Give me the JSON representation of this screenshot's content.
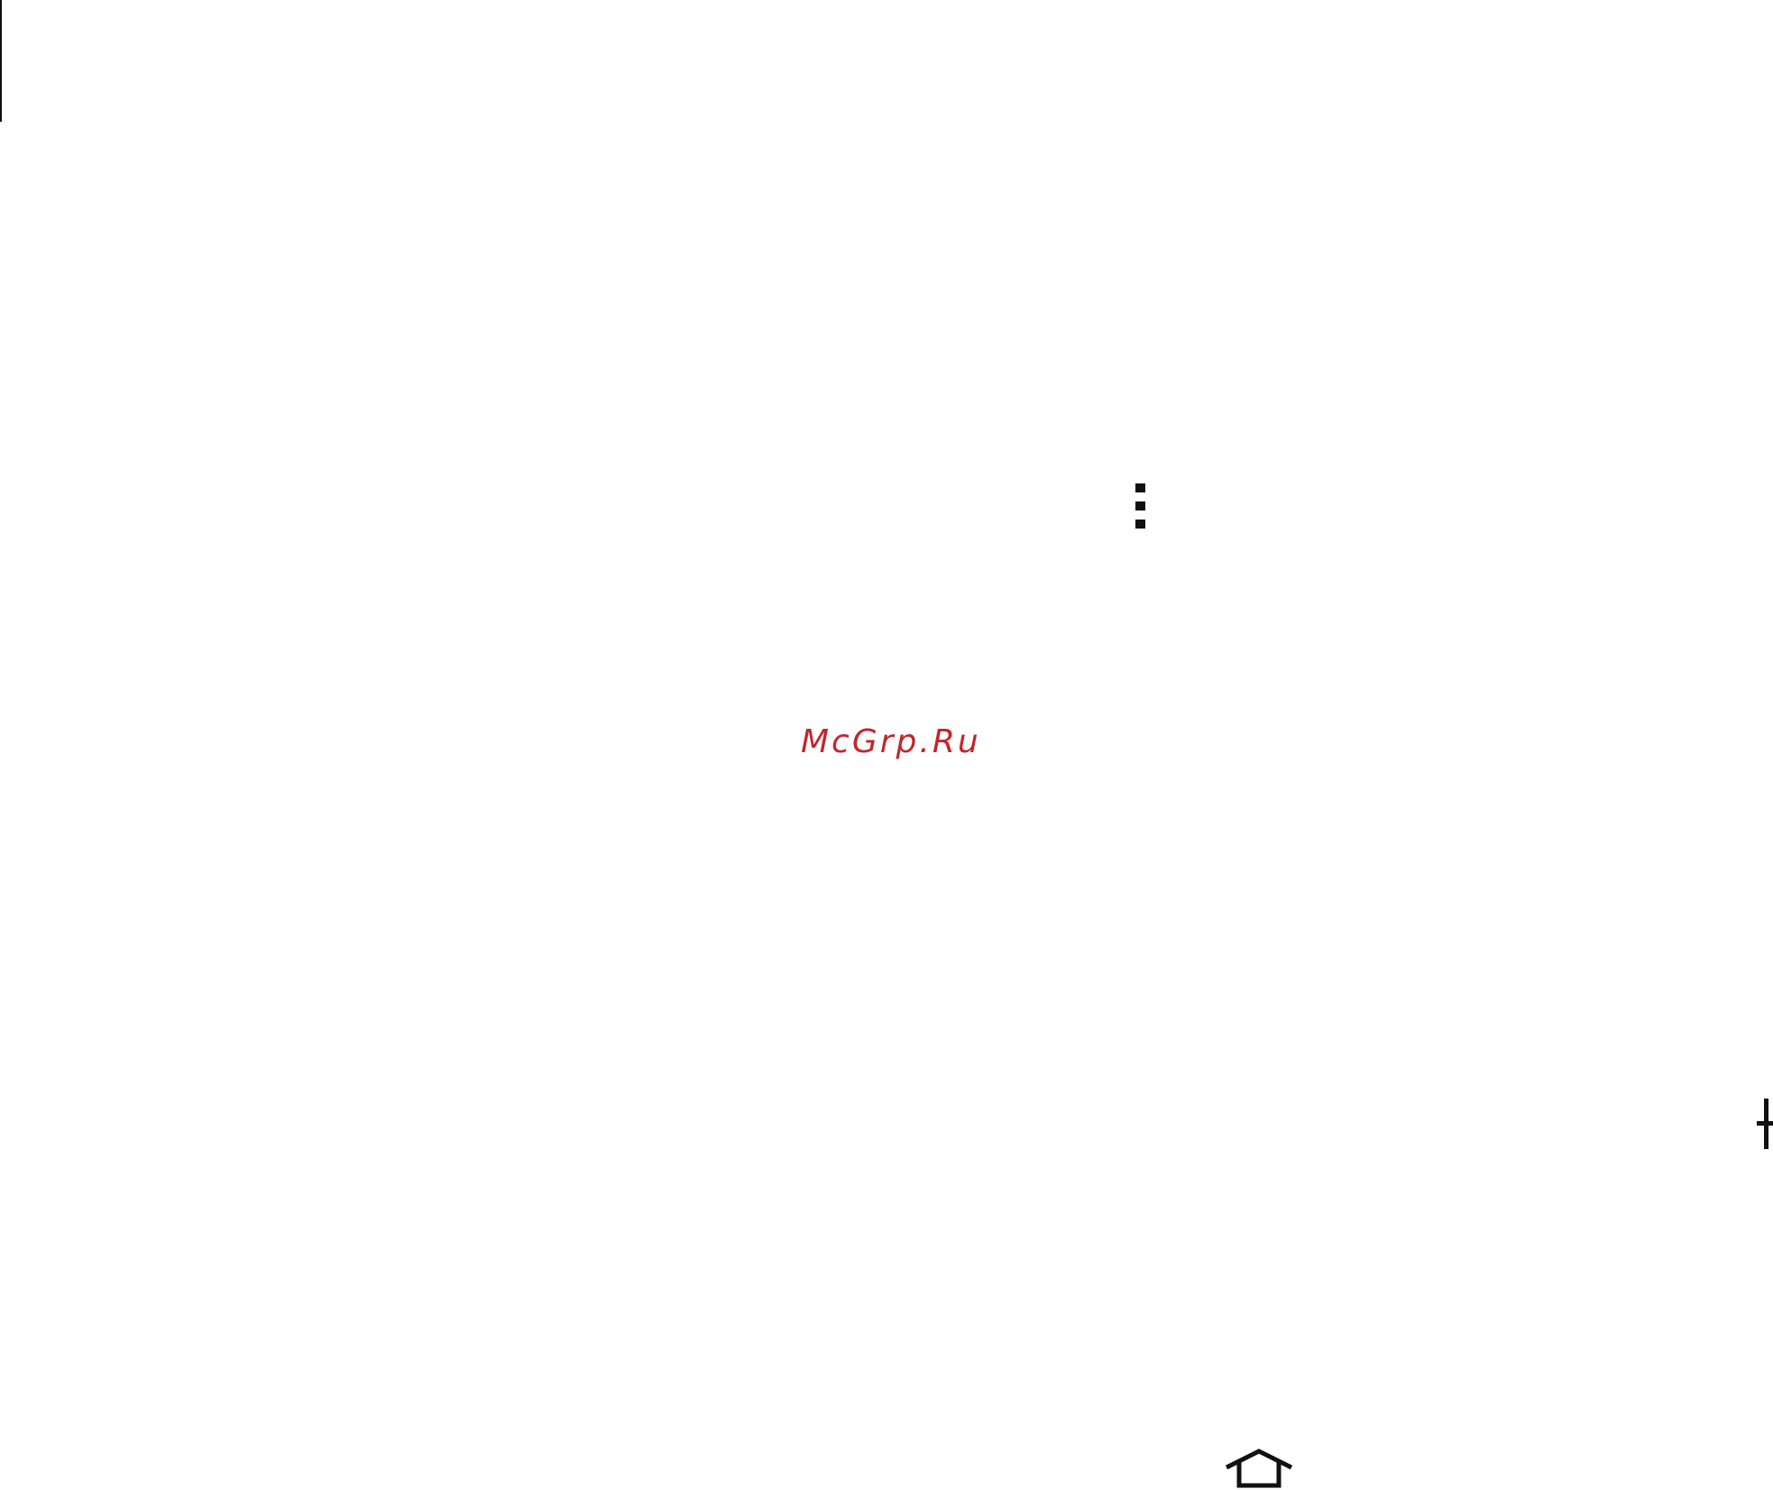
{
  "watermark": {
    "text": "McGrp.Ru",
    "color": "#c0272d"
  },
  "icons": {
    "more": "more-vertical-icon",
    "add": "plus-icon",
    "home": "home-icon"
  },
  "colors": {
    "background": "#ffffff",
    "icon": "#111111"
  }
}
